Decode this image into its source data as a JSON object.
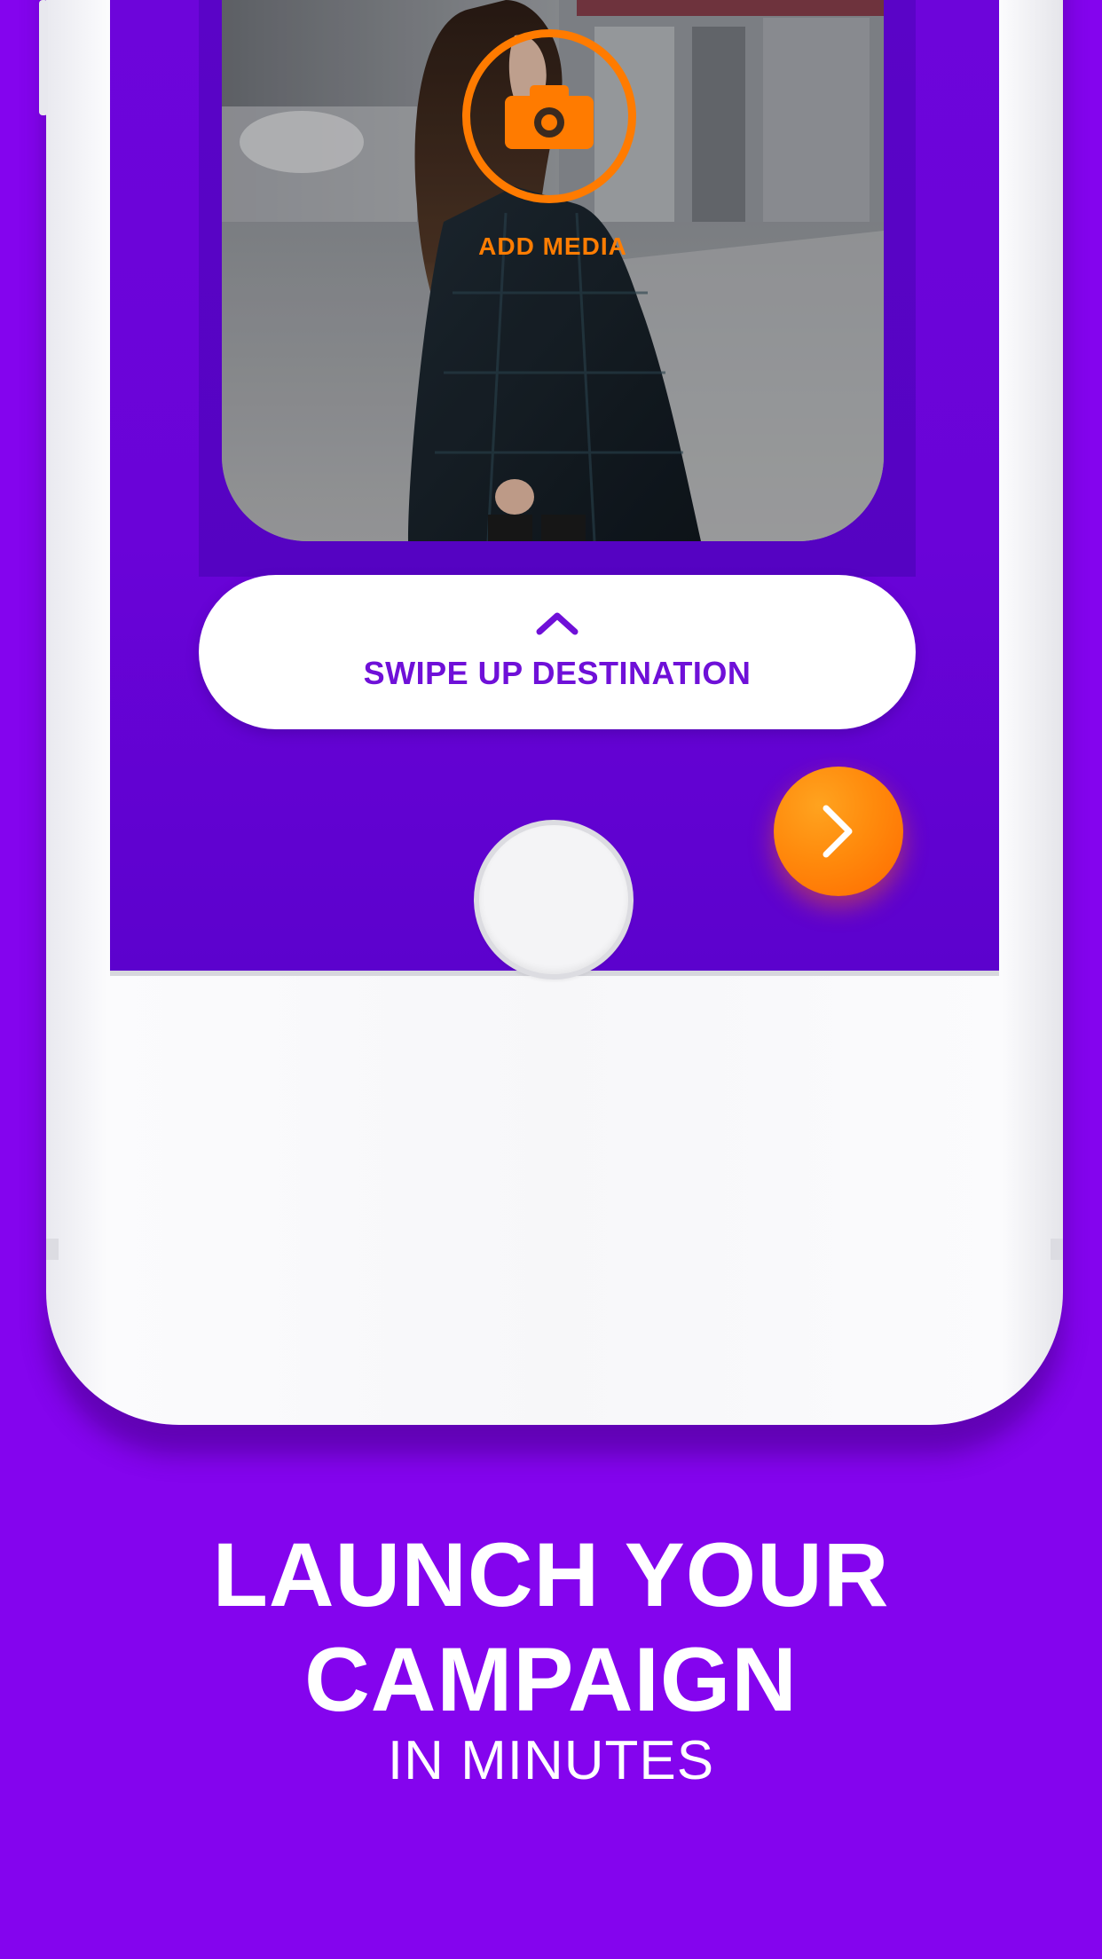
{
  "colors": {
    "background": "#8404ee",
    "screen": "#6a03d8",
    "accent_orange": "#ff7b00",
    "pill_text": "#6f10d8",
    "white": "#ffffff"
  },
  "screen": {
    "add_media": {
      "label": "ADD MEDIA",
      "icon": "camera-icon"
    },
    "swipe_up": {
      "label": "SWIPE UP DESTINATION",
      "icon": "chevron-up-icon"
    },
    "next_button": {
      "icon": "chevron-right-icon"
    }
  },
  "headline": {
    "line1": "LAUNCH YOUR",
    "line2": "CAMPAIGN",
    "subline": "IN MINUTES"
  }
}
